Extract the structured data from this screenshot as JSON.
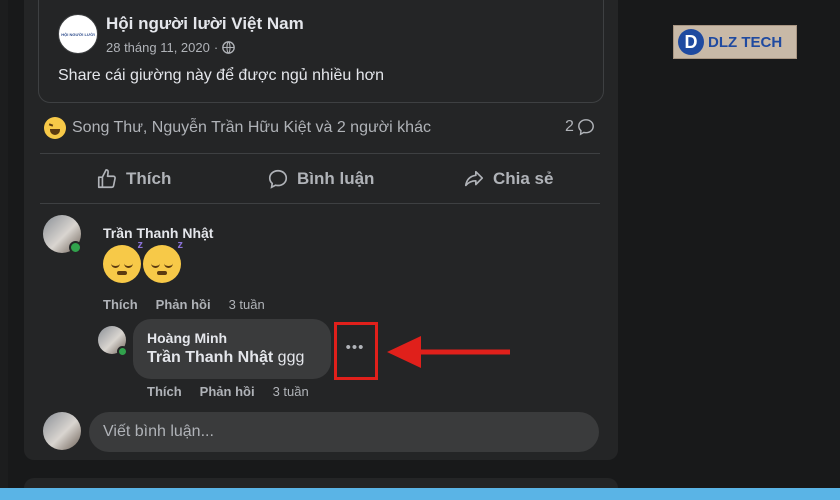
{
  "shared_post": {
    "group_name": "Hội người lười Việt Nam",
    "date": "28 tháng 11, 2020",
    "separator": "·",
    "privacy_icon": "globe-icon",
    "group_avatar_text": "HỘI NGƯỜI LƯỜI",
    "text": "Share cái giường này để được ngủ nhiều hơn"
  },
  "reactions": {
    "emoji": "haha-icon",
    "names": "Song Thư, Nguyễn Trần Hữu Kiệt và 2 người khác",
    "comment_count": "2"
  },
  "actions": {
    "like": "Thích",
    "comment": "Bình luận",
    "share": "Chia sẻ"
  },
  "comments": [
    {
      "name": "Trần Thanh Nhật",
      "emoji_count": 2,
      "like_label": "Thích",
      "reply_label": "Phản hồi",
      "time": "3 tuần",
      "replies": [
        {
          "name": "Hoàng Minh",
          "mention": "Trần Thanh Nhật",
          "text": " ggg",
          "like_label": "Thích",
          "reply_label": "Phản hồi",
          "time": "3 tuần",
          "more_icon": "ellipsis-icon"
        }
      ]
    }
  ],
  "composer": {
    "placeholder": "Viết bình luận..."
  },
  "watermark": {
    "text": "DLZ TECH"
  },
  "colors": {
    "background": "#18191a",
    "card": "#242526",
    "bubble": "#3a3b3c",
    "annotation_red": "#e0201b",
    "online_green": "#31a24c"
  }
}
